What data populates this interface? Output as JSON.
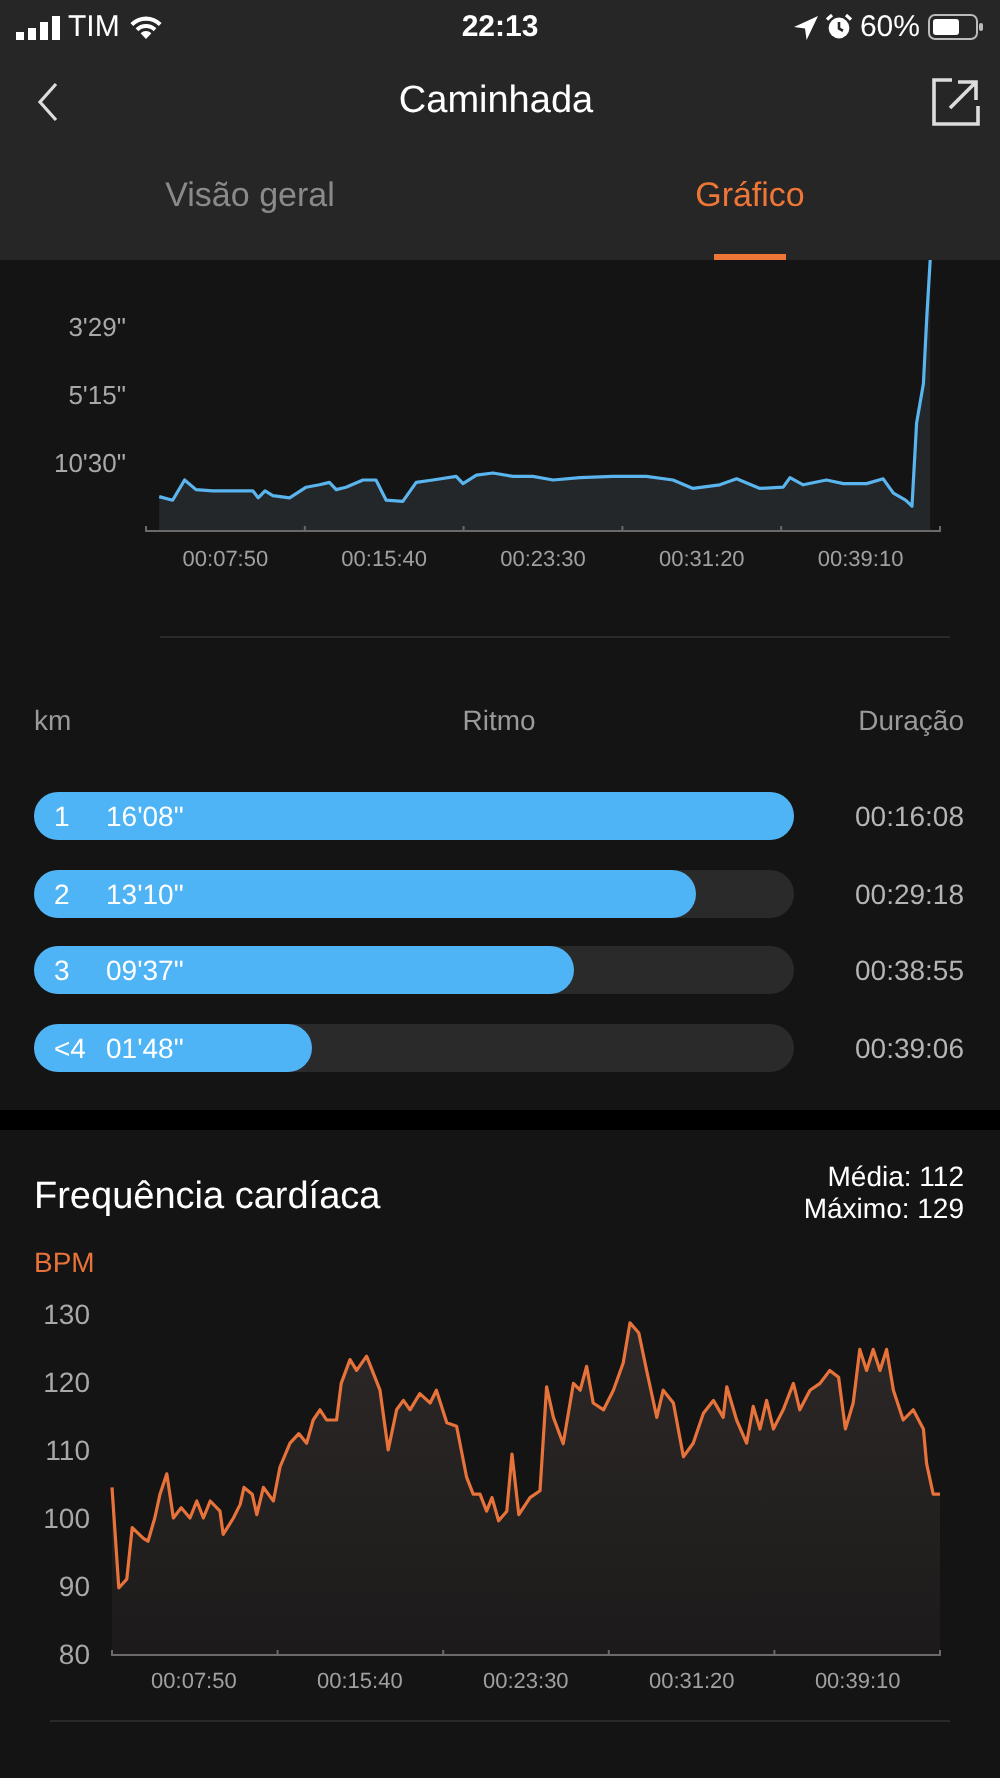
{
  "status_bar": {
    "carrier": "TIM",
    "time": "22:13",
    "battery": "60%"
  },
  "header": {
    "title": "Caminhada"
  },
  "tabs": [
    {
      "label": "Visão geral",
      "selected": false
    },
    {
      "label": "Gráfico",
      "selected": true
    }
  ],
  "pace_chart": {
    "y_axis_labels": [
      "3'29\"",
      "5'15\"",
      "10'30\""
    ],
    "x_axis_labels": [
      "00:07:50",
      "00:15:40",
      "00:23:30",
      "00:31:20",
      "00:39:10"
    ]
  },
  "splits": {
    "columns": [
      "km",
      "Ritmo",
      "Duração"
    ],
    "rows": [
      {
        "km": "1",
        "pace": "16'08\"",
        "level": 1.0,
        "duration": "00:16:08"
      },
      {
        "km": "2",
        "pace": "13'10\"",
        "level": 0.87,
        "duration": "00:29:18"
      },
      {
        "km": "3",
        "pace": "09'37\"",
        "level": 0.71,
        "duration": "00:38:55"
      },
      {
        "km": "<4",
        "pace": "01'48\"",
        "level": 0.366,
        "duration": "00:39:06"
      }
    ]
  },
  "heart_rate": {
    "title": "Frequência cardíaca",
    "average": "Média: 112",
    "maximum": "Máximo: 129",
    "chart_data": {
      "type": "area",
      "ylabel": "BPM",
      "xlim": [
        238,
        2583
      ],
      "ylim": [
        80,
        130
      ],
      "xticks": [
        {
          "value": 470,
          "label": "00:07:50"
        },
        {
          "value": 940,
          "label": "00:15:40"
        },
        {
          "value": 1410,
          "label": "00:23:30"
        },
        {
          "value": 1880,
          "label": "00:31:20"
        },
        {
          "value": 2350,
          "label": "00:39:10"
        }
      ],
      "yticks": [
        80,
        90,
        100,
        110,
        120,
        130
      ],
      "series": [
        {
          "color": "#e8733a",
          "x": [
            238,
            257,
            280,
            295,
            327,
            340,
            359,
            374,
            393,
            412,
            434,
            459,
            478,
            497,
            516,
            544,
            553,
            582,
            601,
            612,
            635,
            648,
            667,
            695,
            714,
            742,
            767,
            789,
            808,
            827,
            846,
            874,
            887,
            912,
            931,
            959,
            997,
            1020,
            1044,
            1063,
            1082,
            1110,
            1139,
            1157,
            1186,
            1214,
            1242,
            1261,
            1280,
            1299,
            1314,
            1333,
            1356,
            1371,
            1390,
            1422,
            1450,
            1469,
            1488,
            1516,
            1545,
            1564,
            1582,
            1601,
            1630,
            1658,
            1686,
            1705,
            1730,
            1752,
            1781,
            1799,
            1828,
            1856,
            1884,
            1913,
            1941,
            1969,
            1979,
            2007,
            2035,
            2054,
            2073,
            2092,
            2111,
            2139,
            2168,
            2186,
            2215,
            2243,
            2271,
            2296,
            2315,
            2337,
            2356,
            2375,
            2394,
            2413,
            2432,
            2451,
            2479,
            2507,
            2536,
            2545,
            2564,
            2583
          ],
          "values": [
            104.5,
            89.7,
            91,
            98.6,
            97,
            96.6,
            100,
            103.5,
            106.5,
            100,
            101.5,
            100,
            102.5,
            100,
            102.5,
            101,
            97.6,
            100,
            102,
            104.5,
            103.5,
            100.5,
            104.5,
            102.5,
            107.5,
            111,
            112.4,
            111,
            114.4,
            115.9,
            114.4,
            114.4,
            119.8,
            123.3,
            121.7,
            123.8,
            118.8,
            110,
            115.9,
            117.3,
            115.9,
            118.3,
            116.9,
            118.8,
            114,
            113.5,
            106,
            103.5,
            103.5,
            101,
            103,
            99.6,
            101,
            109.4,
            100.5,
            103,
            104,
            119.3,
            114.8,
            110.9,
            119.8,
            118.8,
            122.3,
            116.9,
            115.9,
            118.8,
            122.8,
            128.7,
            127.2,
            121.7,
            114.8,
            118.8,
            116.9,
            109,
            111,
            115.4,
            117.3,
            114.8,
            119.3,
            114.4,
            111,
            116.4,
            113.1,
            117.3,
            113.1,
            115.9,
            119.8,
            115.9,
            118.8,
            119.8,
            121.7,
            120.7,
            113.1,
            116.9,
            124.8,
            121.7,
            124.8,
            121.7,
            124.8,
            118.8,
            114.4,
            115.9,
            113.1,
            108,
            103.5,
            103.5
          ]
        }
      ]
    }
  }
}
